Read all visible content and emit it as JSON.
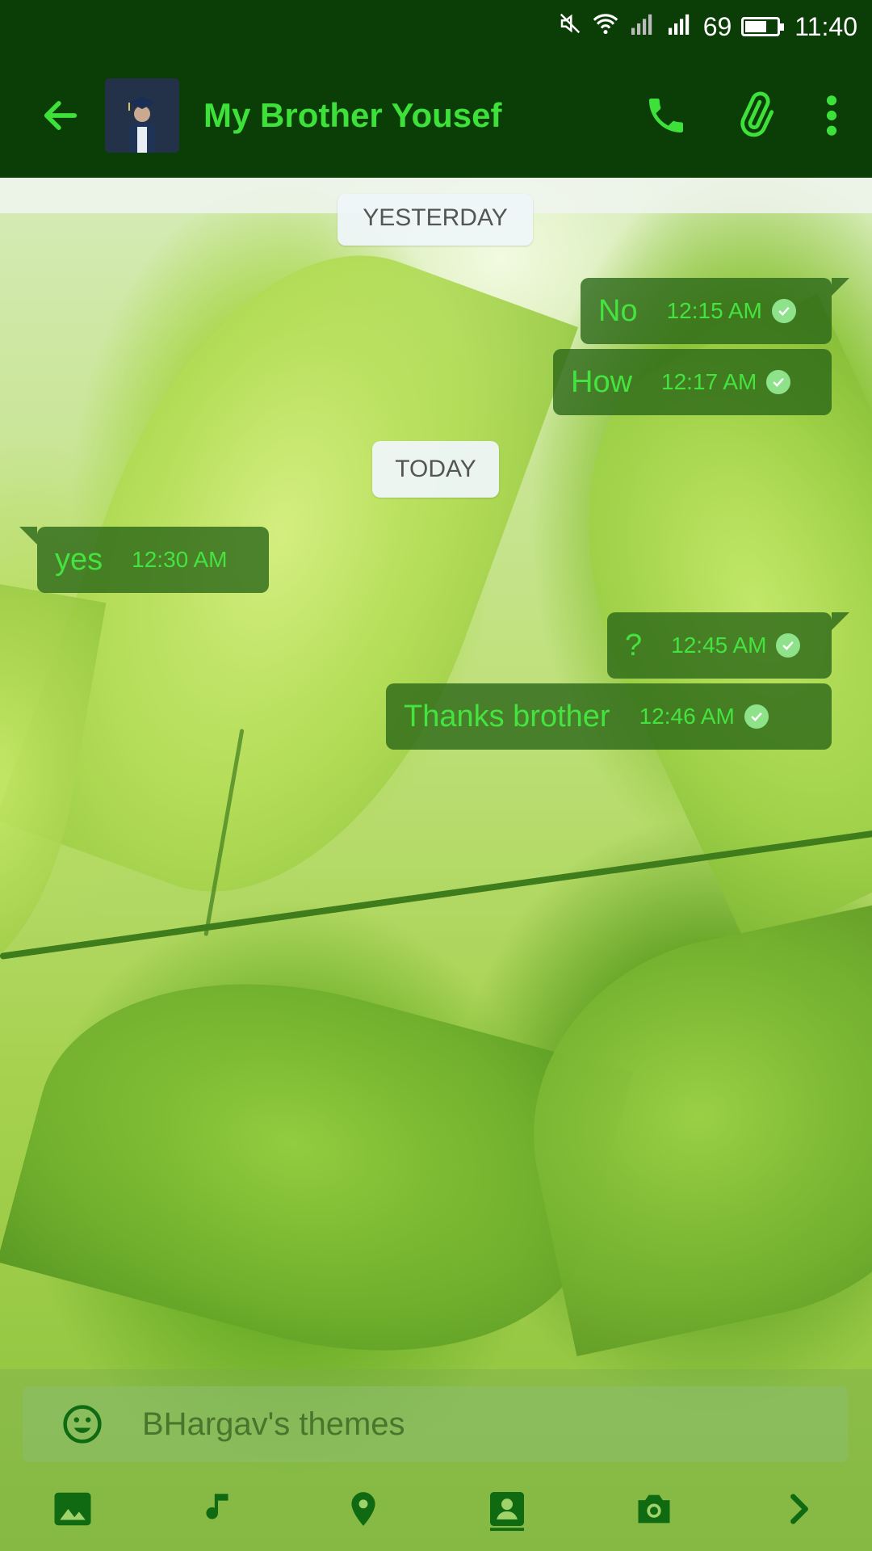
{
  "status_bar": {
    "battery_percent": "69",
    "battery_level": 0.69,
    "time": "11:40"
  },
  "header": {
    "contact_name": "My Brother Yousef"
  },
  "messages": [
    {
      "type": "date",
      "text": "YESTERDAY"
    },
    {
      "type": "sent",
      "text": "No",
      "time": "12:15 AM",
      "status": "read"
    },
    {
      "type": "sent",
      "text": "How",
      "time": "12:17 AM",
      "status": "read"
    },
    {
      "type": "date",
      "text": "TODAY"
    },
    {
      "type": "received",
      "text": "yes",
      "time": "12:30 AM"
    },
    {
      "type": "sent",
      "text": "?",
      "time": "12:45 AM",
      "status": "read"
    },
    {
      "type": "sent",
      "text": "Thanks brother",
      "time": "12:46 AM",
      "status": "read"
    }
  ],
  "composer": {
    "input_value": "BHargav's themes"
  },
  "icons": {
    "back": "back-arrow-icon",
    "call": "phone-icon",
    "attach": "paperclip-icon",
    "menu": "more-vert-icon",
    "emoji": "emoji-icon",
    "gallery": "image-icon",
    "audio": "music-note-icon",
    "location": "location-pin-icon",
    "contact": "contact-card-icon",
    "camera": "camera-icon",
    "more": "chevron-right-icon"
  },
  "colors": {
    "accent": "#3ee03a",
    "header_bg": "#0b3d07",
    "bubble_bg": "#286416"
  }
}
